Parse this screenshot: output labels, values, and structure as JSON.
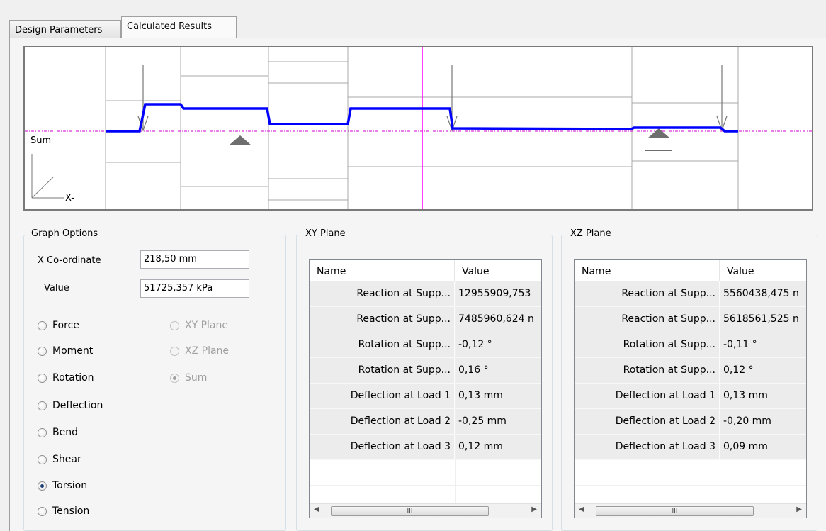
{
  "tabs": [
    {
      "label": "Design Parameters",
      "active": false
    },
    {
      "label": "Calculated Results",
      "active": true
    }
  ],
  "graph": {
    "series_label": "Sum",
    "axis_label": "X-",
    "curve_color": "#0000ff",
    "cursor_color": "#ff00ff"
  },
  "graph_options": {
    "title": "Graph Options",
    "x_coordinate_label": "X Co-ordinate",
    "x_coordinate_value": "218,50 mm",
    "value_label": "Value",
    "value_value": "51725,357 kPa",
    "quantity_options": [
      {
        "label": "Force",
        "selected": false
      },
      {
        "label": "Moment",
        "selected": false
      },
      {
        "label": "Rotation",
        "selected": false
      },
      {
        "label": "Deflection",
        "selected": false
      },
      {
        "label": "Bend",
        "selected": false
      },
      {
        "label": "Shear",
        "selected": false
      },
      {
        "label": "Torsion",
        "selected": true
      },
      {
        "label": "Tension",
        "selected": false
      }
    ],
    "plane_options": [
      {
        "label": "XY Plane",
        "selected": false,
        "enabled": false
      },
      {
        "label": "XZ Plane",
        "selected": false,
        "enabled": false
      },
      {
        "label": "Sum",
        "selected": true,
        "enabled": false
      }
    ]
  },
  "xy_plane": {
    "title": "XY Plane",
    "columns": [
      "Name",
      "Value"
    ],
    "rows": [
      [
        "Reaction at Supp...",
        "12955909,753"
      ],
      [
        "Reaction at Supp...",
        "7485960,624 n"
      ],
      [
        "Rotation at Supp...",
        "-0,12 °"
      ],
      [
        "Rotation at Supp...",
        "0,16 °"
      ],
      [
        "Deflection at Load 1",
        "0,13 mm"
      ],
      [
        "Deflection at Load 2",
        "-0,25 mm"
      ],
      [
        "Deflection at Load 3",
        "0,12 mm"
      ]
    ]
  },
  "xz_plane": {
    "title": "XZ Plane",
    "columns": [
      "Name",
      "Value"
    ],
    "rows": [
      [
        "Reaction at Supp...",
        "5560438,475 n"
      ],
      [
        "Reaction at Supp...",
        "5618561,525 n"
      ],
      [
        "Rotation at Supp...",
        "-0,11 °"
      ],
      [
        "Rotation at Supp...",
        "0,12 °"
      ],
      [
        "Deflection at Load 1",
        "0,13 mm"
      ],
      [
        "Deflection at Load 2",
        "-0,20 mm"
      ],
      [
        "Deflection at Load 3",
        "0,09 mm"
      ]
    ]
  },
  "scrollbar_thumb_glyph": "III"
}
